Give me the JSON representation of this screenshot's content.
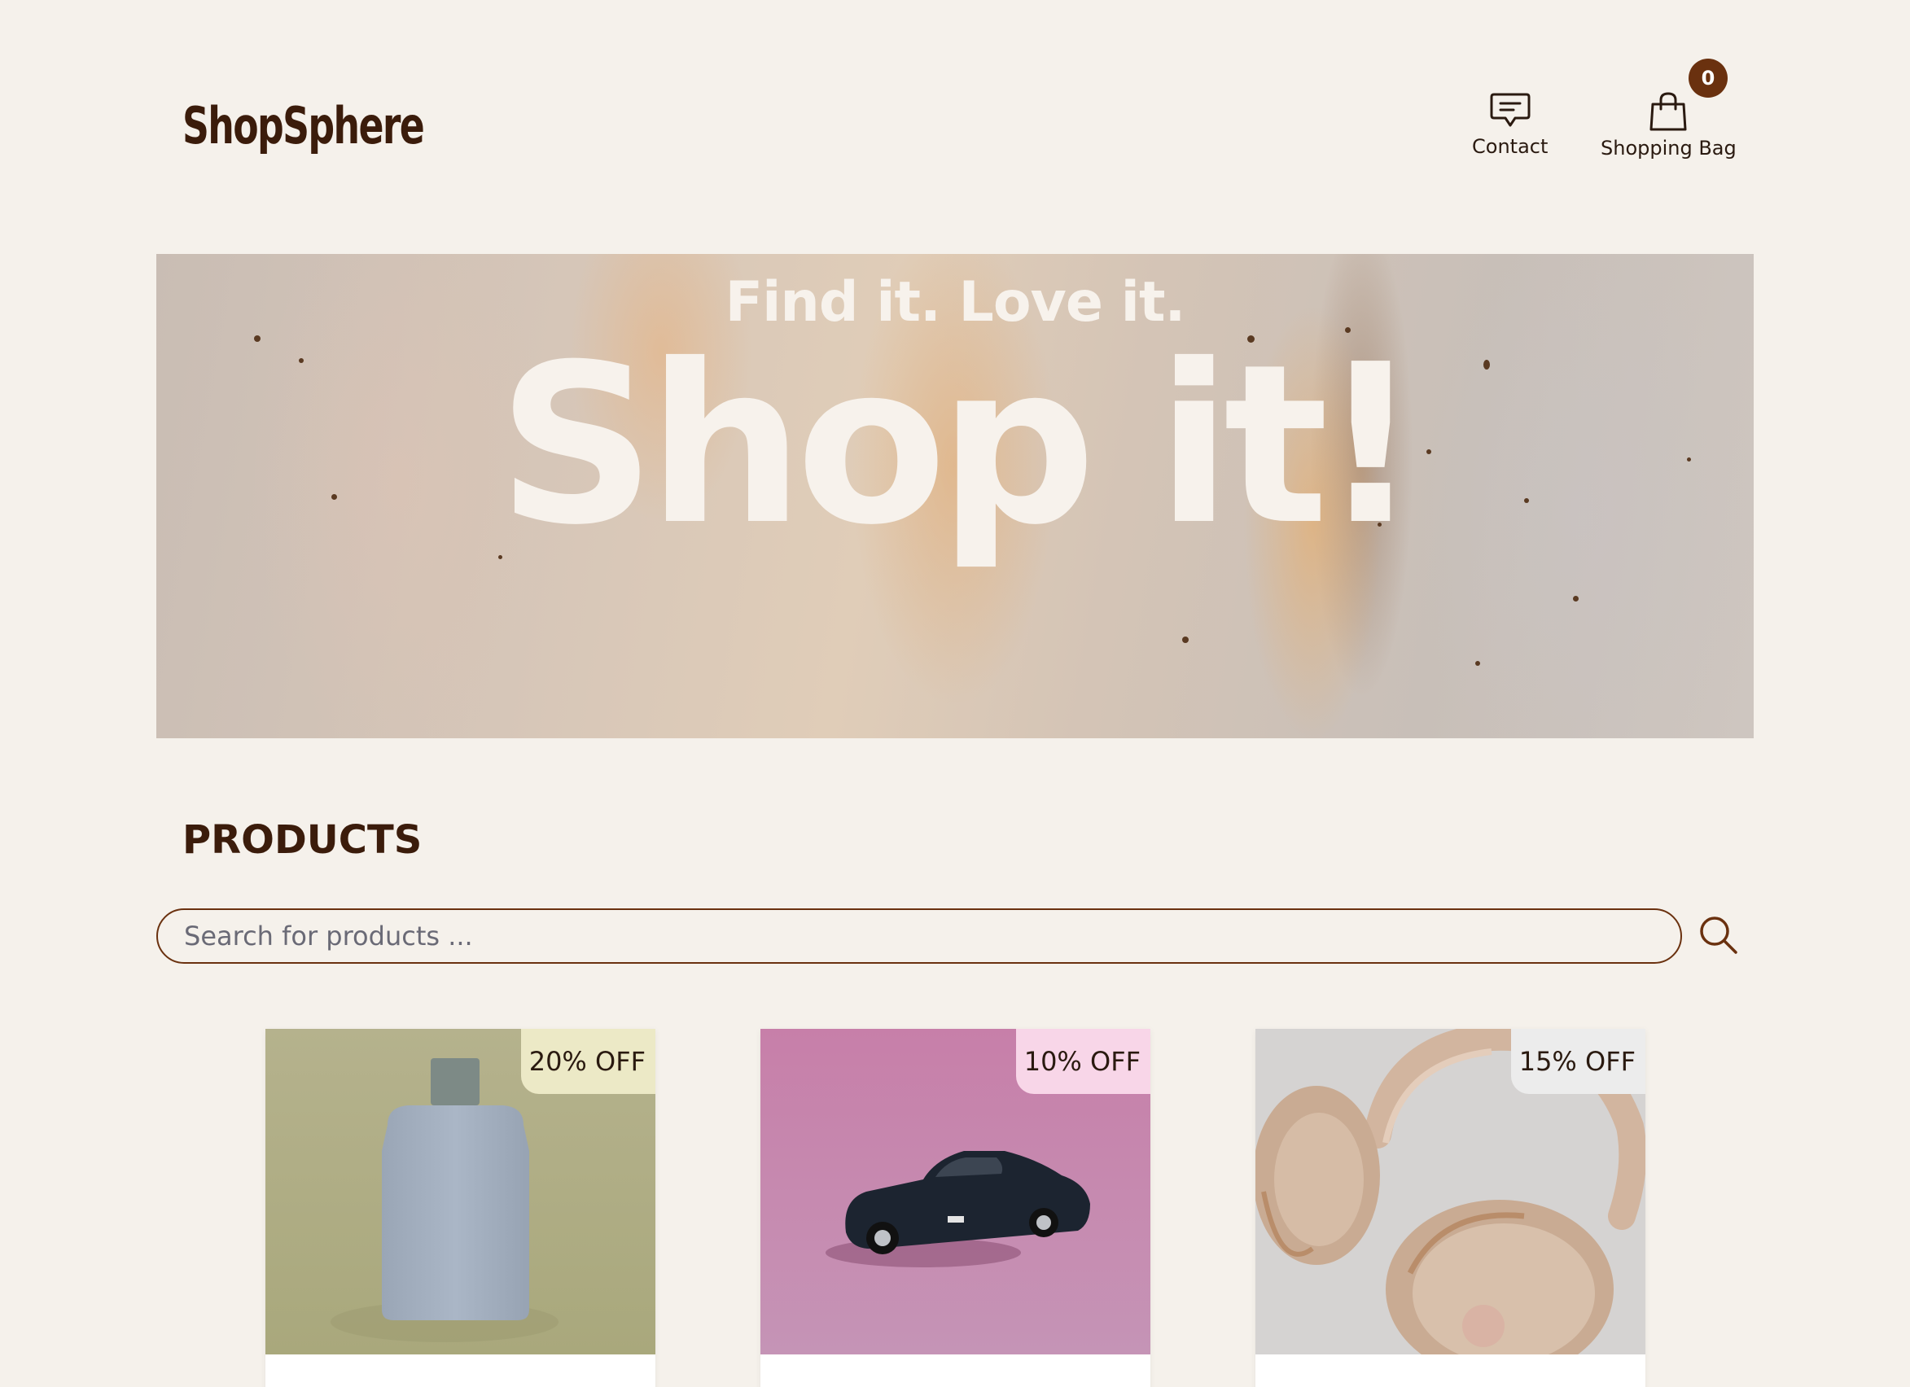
{
  "header": {
    "logo": "ShopSphere",
    "nav": {
      "contact_label": "Contact",
      "bag_label": "Shopping Bag",
      "bag_count": "0"
    }
  },
  "hero": {
    "subtitle": "Find it. Love it.",
    "title": "Shop it!"
  },
  "products": {
    "heading": "PRODUCTS",
    "search_placeholder": "Search for products ...",
    "items": [
      {
        "discount": "20% OFF",
        "image": "perfume-bottle",
        "badge_color": "#ece9c6"
      },
      {
        "discount": "10% OFF",
        "image": "toy-car",
        "badge_color": "#f8d6e8"
      },
      {
        "discount": "15% OFF",
        "image": "headphones",
        "badge_color": "#ececec"
      }
    ]
  },
  "colors": {
    "background": "#f5f1eb",
    "brand_dark": "#3b1c0b",
    "accent": "#6a310f"
  }
}
